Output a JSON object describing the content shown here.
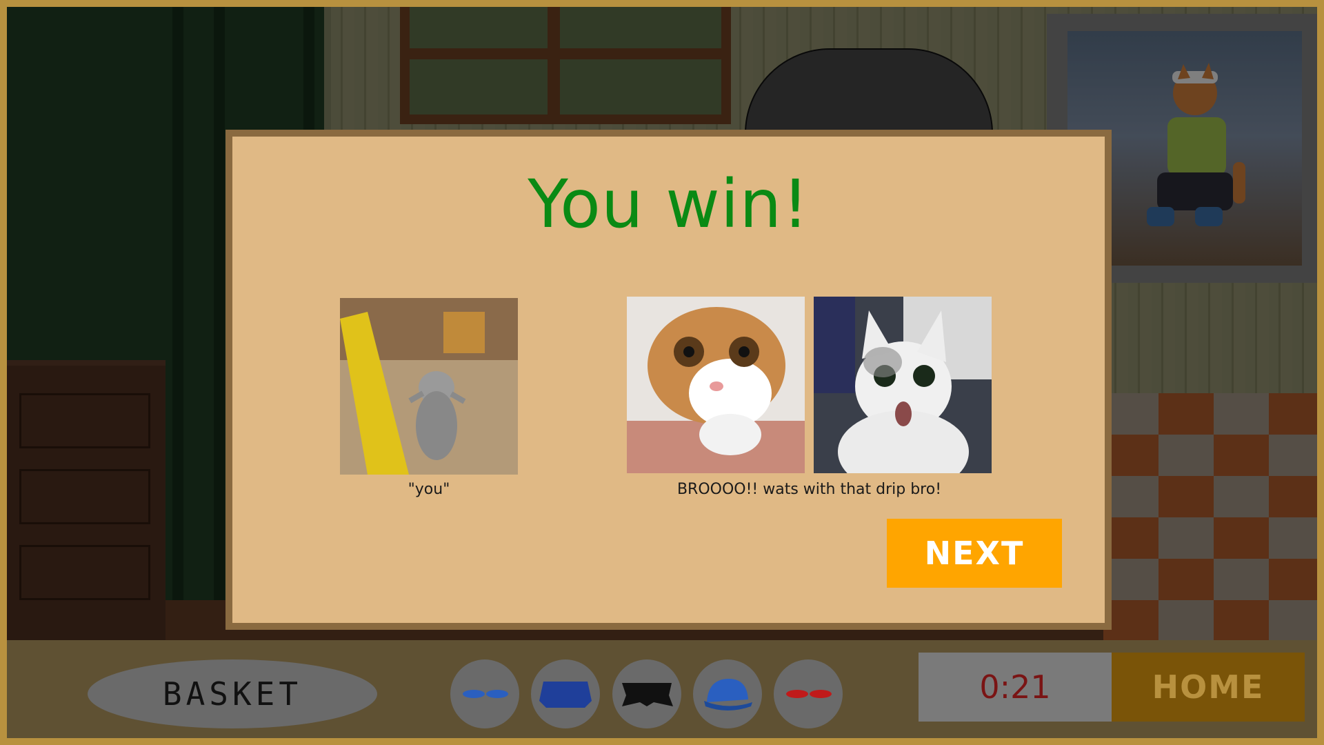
{
  "modal": {
    "title": "You win!",
    "left_caption": "\"you\"",
    "right_caption": "BROOOO!! wats with that drip bro!",
    "next_label": "NEXT"
  },
  "bottom_bar": {
    "basket_label": "BASKET",
    "timer": "0:21",
    "home_label": "HOME",
    "slots": [
      {
        "icon": "sunglasses-icon",
        "color": "#2a5fc0"
      },
      {
        "icon": "shirt-icon",
        "color": "#1f3f9a"
      },
      {
        "icon": "pants-icon",
        "color": "#111111"
      },
      {
        "icon": "cap-icon",
        "color": "#2a5fc0"
      },
      {
        "icon": "red-glasses-icon",
        "color": "#c01a1a"
      }
    ]
  },
  "colors": {
    "title_green": "#0a8a14",
    "next_orange": "#ffa500",
    "modal_bg": "#e0b985",
    "frame_gold": "#b8913f"
  }
}
